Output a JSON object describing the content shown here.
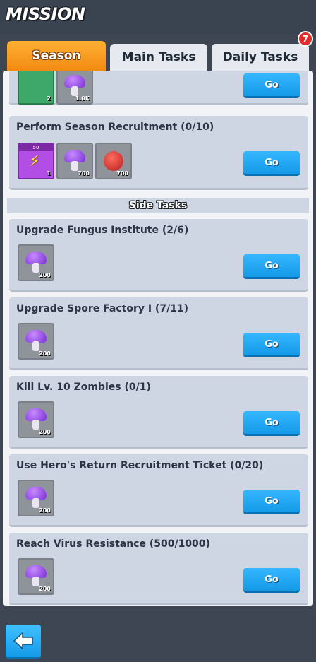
{
  "header": {
    "title": "MISSION"
  },
  "tabs": [
    {
      "label": "Season",
      "active": true
    },
    {
      "label": "Main Tasks",
      "active": false
    },
    {
      "label": "Daily Tasks",
      "active": false,
      "badge": "7"
    }
  ],
  "season_tasks": [
    {
      "title": "",
      "button": "Go",
      "rewards": [
        {
          "icon": "coin-stack-icon",
          "qty": "2"
        },
        {
          "icon": "mushroom-icon",
          "qty": "1.0K"
        }
      ]
    },
    {
      "title": "Perform Season Recruitment (0/10)",
      "button": "Go",
      "rewards": [
        {
          "icon": "energy-bolt-icon",
          "qty": "1",
          "tag": "50"
        },
        {
          "icon": "mushroom-icon",
          "qty": "700"
        },
        {
          "icon": "virus-icon",
          "qty": "700"
        }
      ]
    }
  ],
  "side_tasks_header": "Side Tasks",
  "side_tasks": [
    {
      "title": "Upgrade Fungus Institute (2/6)",
      "button": "Go",
      "reward": {
        "icon": "mushroom-icon",
        "qty": "200"
      }
    },
    {
      "title": "Upgrade Spore Factory I (7/11)",
      "button": "Go",
      "reward": {
        "icon": "mushroom-icon",
        "qty": "200"
      }
    },
    {
      "title": "Kill Lv. 10 Zombies (0/1)",
      "button": "Go",
      "reward": {
        "icon": "mushroom-icon",
        "qty": "200"
      }
    },
    {
      "title": "Use Hero's Return Recruitment Ticket (0/20)",
      "button": "Go",
      "reward": {
        "icon": "mushroom-icon",
        "qty": "200"
      }
    },
    {
      "title": "Reach Virus Resistance (500/1000)",
      "button": "Go",
      "reward": {
        "icon": "mushroom-icon",
        "qty": "200"
      }
    }
  ],
  "footer": {
    "back_icon": "back-arrow-icon"
  }
}
